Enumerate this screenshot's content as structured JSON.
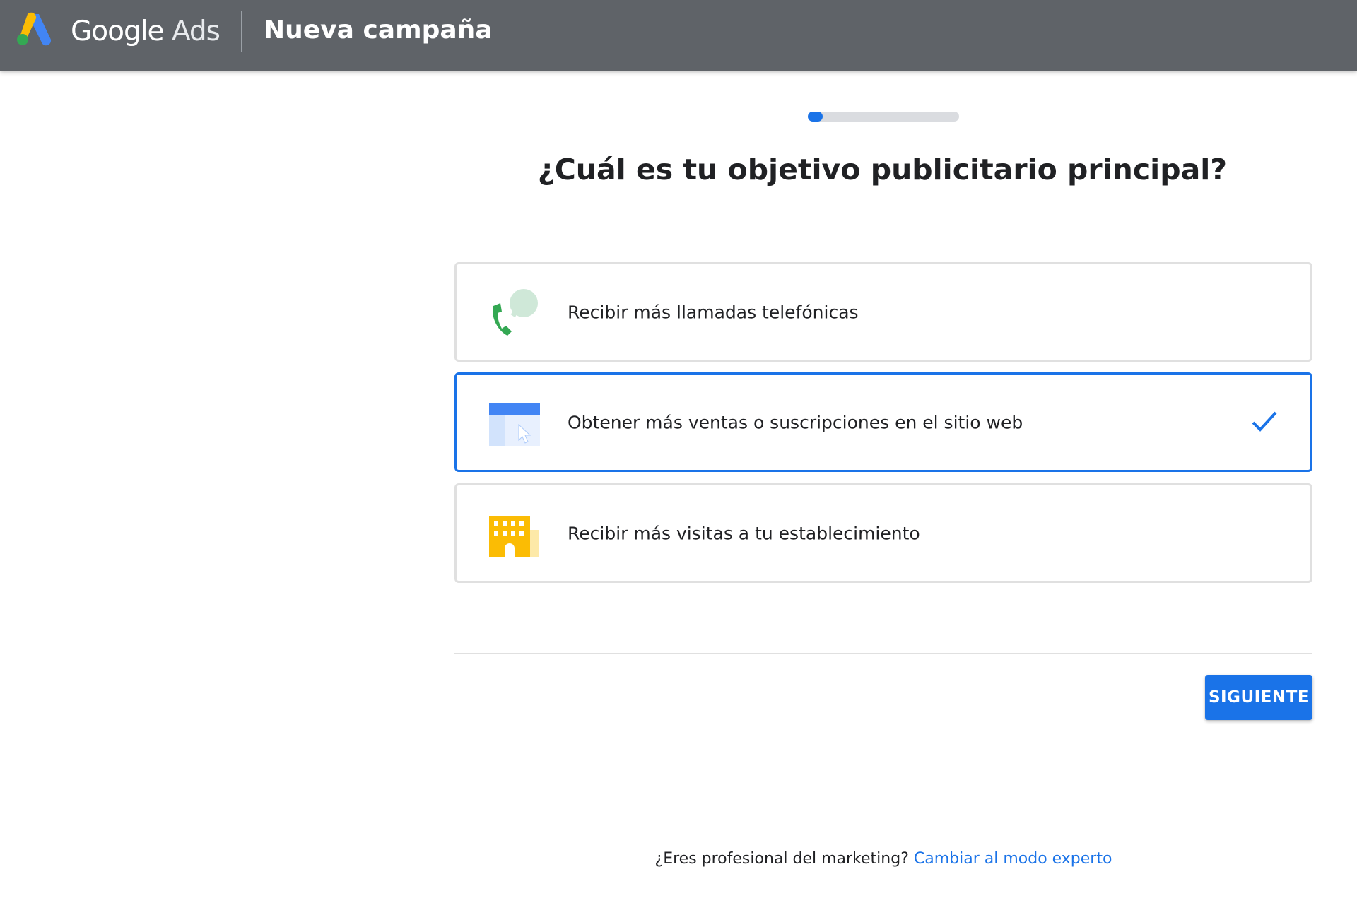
{
  "header": {
    "logo_google": "Google",
    "logo_ads": "Ads",
    "title": "Nueva campaña",
    "logo_icon": "google-ads-logo-icon"
  },
  "progress": {
    "value": 0.1
  },
  "main": {
    "question": "¿Cuál es tu objetivo publicitario principal?",
    "options": [
      {
        "label": "Recibir más llamadas telefónicas",
        "icon": "phone-call-icon",
        "selected": false
      },
      {
        "label": "Obtener más ventas o suscripciones en el sitio web",
        "icon": "website-click-icon",
        "selected": true
      },
      {
        "label": "Recibir más visitas a tu establecimiento",
        "icon": "storefront-icon",
        "selected": false
      }
    ],
    "selected_icon": "checkmark-icon",
    "next_label": "SIGUIENTE"
  },
  "footer": {
    "prompt": "¿Eres profesional del marketing?",
    "link": "Cambiar al modo experto"
  },
  "colors": {
    "topbar": "#5f6368",
    "accent": "#1a73e8",
    "phone_green": "#34a853",
    "building_yellow": "#fbbc04"
  }
}
